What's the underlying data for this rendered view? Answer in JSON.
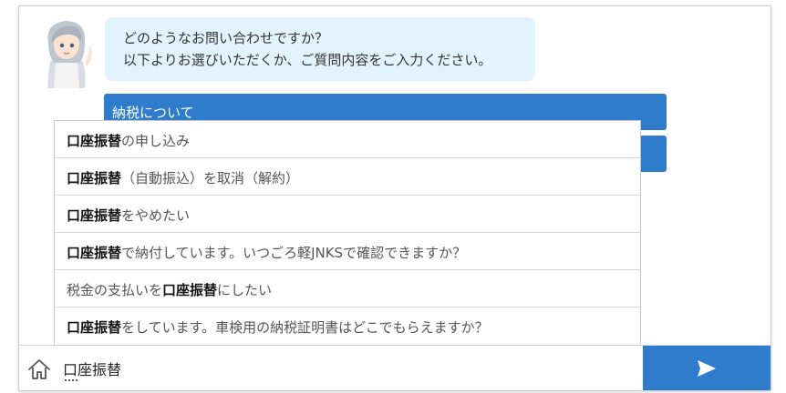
{
  "chat": {
    "bot_message": {
      "line1": "どのようなお問い合わせですか？",
      "line2": "以下よりお選びいただくか、ご質問内容をご入力ください。"
    },
    "choices": [
      {
        "label": "納税について"
      },
      {
        "label": ""
      }
    ]
  },
  "suggestions": [
    {
      "before": "",
      "match": "口座振替",
      "after": "の申し込み"
    },
    {
      "before": "",
      "match": "口座振替",
      "after": "（自動振込）を取消（解約）"
    },
    {
      "before": "",
      "match": "口座振替",
      "after": "をやめたい"
    },
    {
      "before": "",
      "match": "口座振替",
      "after": "で納付しています。いつごろ軽JNKSで確認できますか？"
    },
    {
      "before": "税金の支払いを",
      "match": "口座振替",
      "after": "にしたい"
    },
    {
      "before": "",
      "match": "口座振替",
      "after": "をしています。車検用の納税証明書はどこでもらえますか？"
    }
  ],
  "input": {
    "value": "口座振替"
  },
  "icons": {
    "home": "home-icon",
    "send": "send-arrow-icon",
    "avatar": "assistant-avatar"
  },
  "colors": {
    "accent": "#2f7ccc",
    "bot_bubble": "#e3f3fd"
  }
}
